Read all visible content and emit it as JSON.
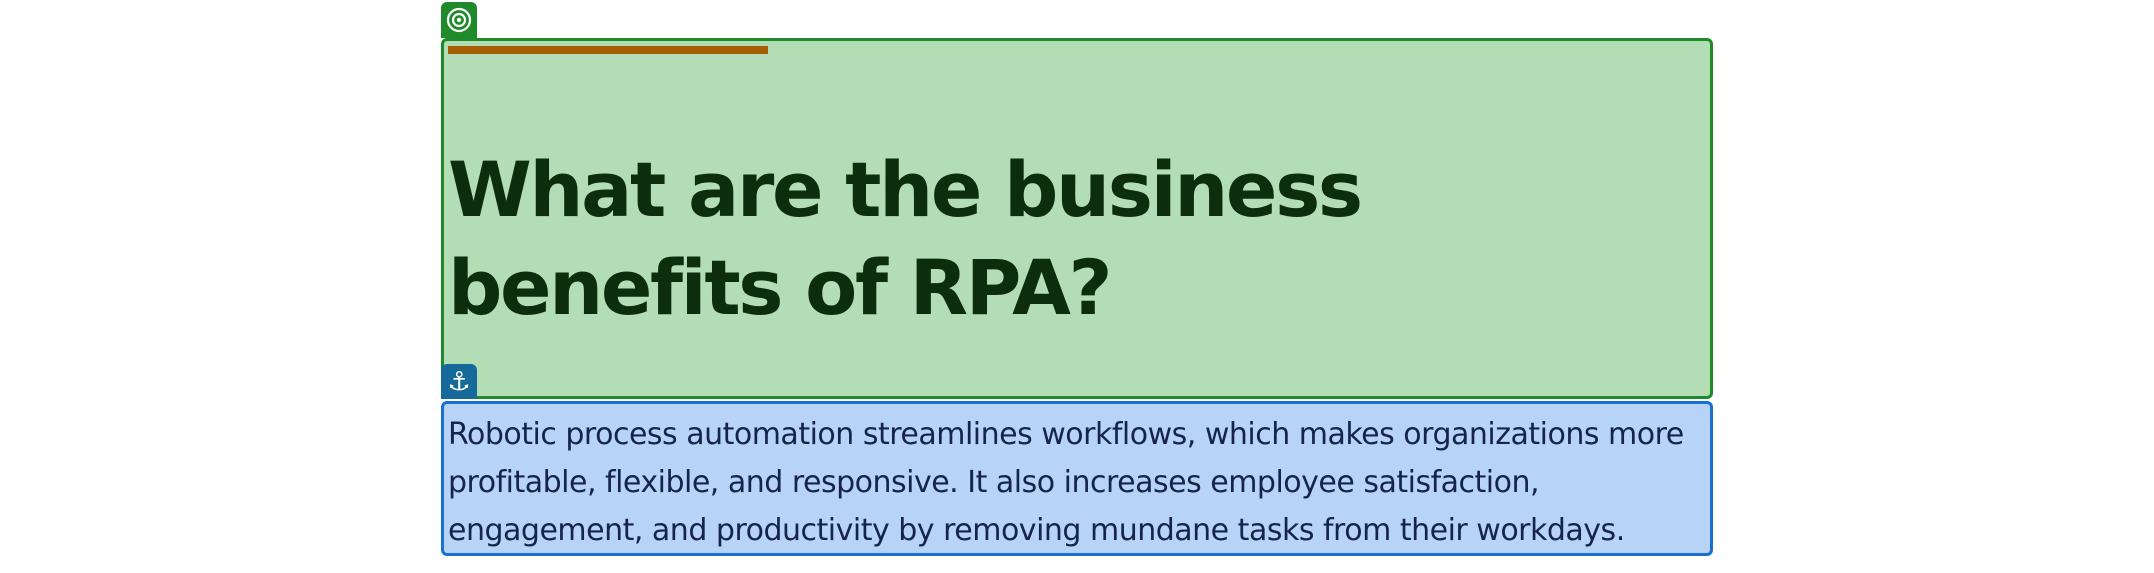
{
  "article": {
    "heading": "What are the business benefits of RPA?",
    "paragraph": "Robotic process automation streamlines workflows, which makes organizations more profitable, flexible, and responsive. It also increases employee satisfaction, engagement, and productivity by removing mundane tasks from their workdays."
  },
  "annotations": {
    "heading_marker_icon": "target-icon",
    "paragraph_marker_icon": "anchor-icon",
    "heading_box_color": "#1e8a2a",
    "heading_fill_color": "#b3ddb4",
    "paragraph_box_color": "#1a6fd4",
    "paragraph_fill_color": "#b7d3f8",
    "accent_color": "#a65d07"
  }
}
